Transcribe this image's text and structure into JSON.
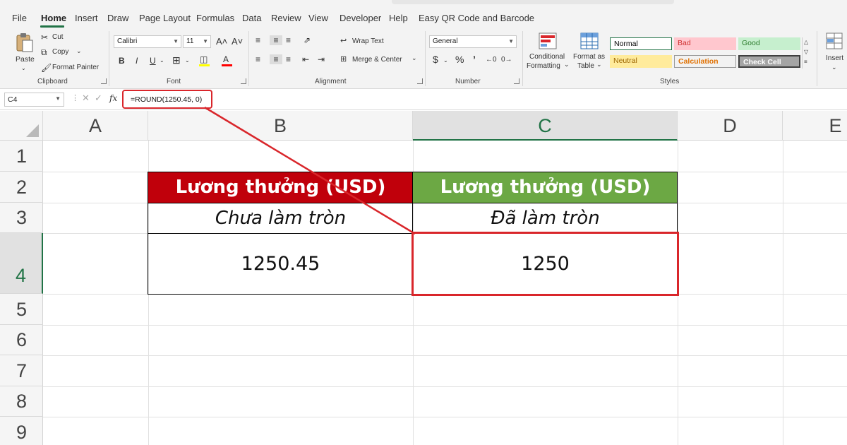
{
  "menu": {
    "items": [
      "File",
      "Home",
      "Insert",
      "Draw",
      "Page Layout",
      "Formulas",
      "Data",
      "Review",
      "View",
      "Developer",
      "Help",
      "Easy QR Code and Barcode"
    ],
    "active": "Home"
  },
  "ribbon": {
    "clipboard": {
      "paste": "Paste",
      "cut": "Cut",
      "copy": "Copy",
      "format_painter": "Format Painter",
      "group": "Clipboard"
    },
    "font": {
      "name": "Calibri",
      "size": "11",
      "bold": "B",
      "italic": "I",
      "underline": "U",
      "grow": "A˄",
      "shrink": "A˅",
      "group": "Font"
    },
    "alignment": {
      "wrap_text": "Wrap Text",
      "merge_center": "Merge & Center",
      "group": "Alignment"
    },
    "number": {
      "format": "General",
      "currency": "$",
      "percent": "%",
      "comma": "’",
      "group": "Number"
    },
    "styles": {
      "conditional_formatting": [
        "Conditional",
        "Formatting"
      ],
      "format_as_table": [
        "Format as",
        "Table"
      ],
      "normal": "Normal",
      "bad": "Bad",
      "good": "Good",
      "neutral": "Neutral",
      "calculation": "Calculation",
      "check_cell": "Check Cell",
      "group": "Styles"
    },
    "insert": "Insert"
  },
  "formula_bar": {
    "name_box": "C4",
    "fx": "fx",
    "formula": "=ROUND(1250.45, 0)"
  },
  "sheet": {
    "columns": [
      "A",
      "B",
      "C",
      "D",
      "E"
    ],
    "rows": [
      "1",
      "2",
      "3",
      "4",
      "5",
      "6",
      "7",
      "8",
      "9"
    ],
    "selected_cell": "C4",
    "b2": "Lương thưởng (USD)",
    "c2": "Lương thưởng (USD)",
    "b3": "Chưa làm tròn",
    "c3": "Đã làm tròn",
    "b4": "1250.45",
    "c4": "1250"
  },
  "colors": {
    "header_red": "#c0000b",
    "header_green": "#6ca844",
    "highlight": "#d9262b",
    "excel_green": "#217346"
  }
}
